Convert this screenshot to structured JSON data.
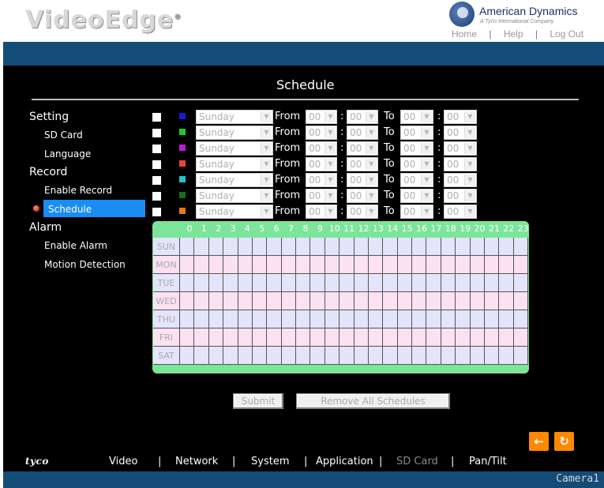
{
  "header": {
    "logo": "VideoEdge",
    "brand_name": "American Dynamics",
    "brand_tagline": "A Tyco International Company",
    "links": [
      "Home",
      "Help",
      "Log Out"
    ],
    "separator": "|"
  },
  "page": {
    "title": "Schedule"
  },
  "nav": {
    "sections": [
      {
        "label": "Setting",
        "items": [
          "SD Card",
          "Language"
        ]
      },
      {
        "label": "Record",
        "items": [
          "Enable Record",
          "Schedule"
        ]
      },
      {
        "label": "Alarm",
        "items": [
          "Enable Alarm",
          "Motion Detection"
        ]
      }
    ],
    "selected": "Schedule"
  },
  "schedule_rows": [
    {
      "color": "#1a1adc",
      "day": "Sunday",
      "from_h": "00",
      "from_m": "00",
      "to_h": "00",
      "to_m": "00"
    },
    {
      "color": "#18cc30",
      "day": "Sunday",
      "from_h": "00",
      "from_m": "00",
      "to_h": "00",
      "to_m": "00"
    },
    {
      "color": "#b51fd0",
      "day": "Sunday",
      "from_h": "00",
      "from_m": "00",
      "to_h": "00",
      "to_m": "00"
    },
    {
      "color": "#ef3f3f",
      "day": "Sunday",
      "from_h": "00",
      "from_m": "00",
      "to_h": "00",
      "to_m": "00"
    },
    {
      "color": "#22c3cc",
      "day": "Sunday",
      "from_h": "00",
      "from_m": "00",
      "to_h": "00",
      "to_m": "00"
    },
    {
      "color": "#1c6d16",
      "day": "Sunday",
      "from_h": "00",
      "from_m": "00",
      "to_h": "00",
      "to_m": "00"
    },
    {
      "color": "#e87812",
      "day": "Sunday",
      "from_h": "00",
      "from_m": "00",
      "to_h": "00",
      "to_m": "00"
    }
  ],
  "labels": {
    "from": "From",
    "to": "To",
    "colon": ":"
  },
  "grid": {
    "hours": [
      "0",
      "1",
      "2",
      "3",
      "4",
      "5",
      "6",
      "7",
      "8",
      "9",
      "10",
      "11",
      "12",
      "13",
      "14",
      "15",
      "16",
      "17",
      "18",
      "19",
      "20",
      "21",
      "22",
      "23"
    ],
    "days": [
      "SUN",
      "MON",
      "TUE",
      "WED",
      "THU",
      "FRI",
      "SAT"
    ],
    "row_colors": [
      "#e4e4fb",
      "#fbe1f1",
      "#e4e4fb",
      "#fbe1f1",
      "#e4e4fb",
      "#fbe1f1",
      "#e4e4fb"
    ]
  },
  "buttons": {
    "submit": "Submit",
    "remove_all": "Remove All Schedules"
  },
  "icons": {
    "back": "arrow-left-icon",
    "refresh": "refresh-icon"
  },
  "footer": {
    "logo": "tyco",
    "nav": [
      "Video",
      "Network",
      "System",
      "Application",
      "SD Card",
      "Pan/Tilt"
    ],
    "disabled": [
      "SD Card"
    ],
    "camera": "Camera1"
  }
}
